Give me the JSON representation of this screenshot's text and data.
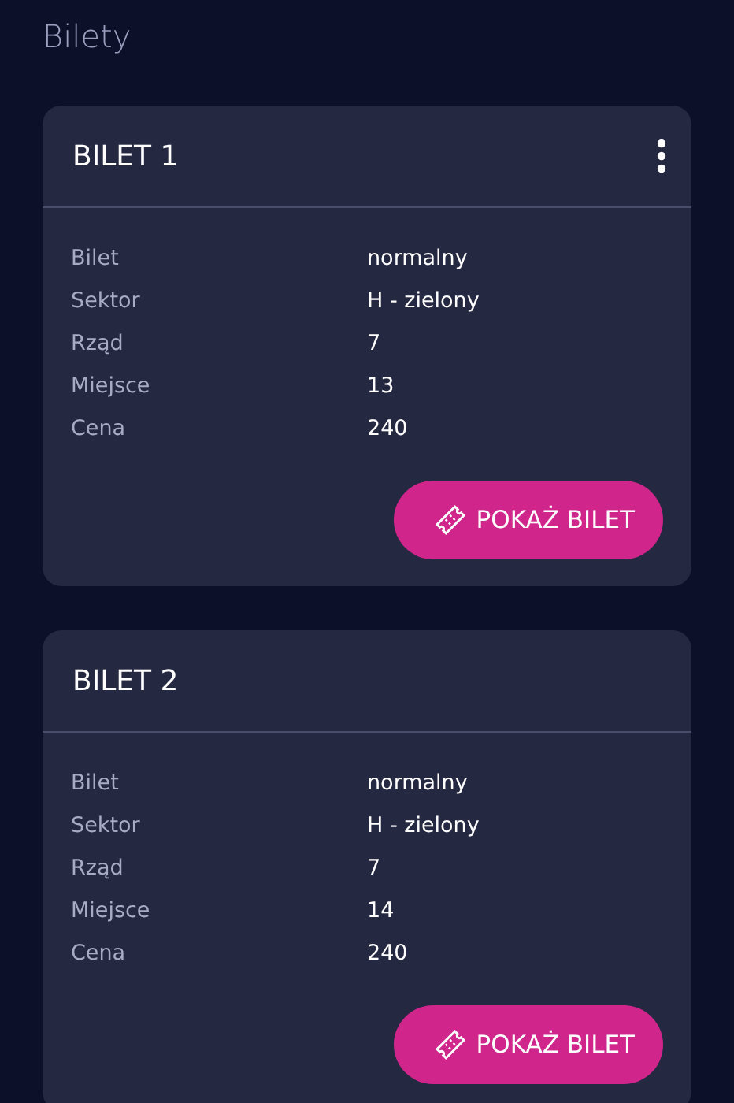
{
  "title": "Bilety",
  "tickets": [
    {
      "name": "BILET 1",
      "menu": true,
      "rows": [
        {
          "label": "Bilet",
          "value": "normalny"
        },
        {
          "label": "Sektor",
          "value": "H - zielony"
        },
        {
          "label": "Rząd",
          "value": "7"
        },
        {
          "label": "Miejsce",
          "value": "13"
        },
        {
          "label": "Cena",
          "value": "240"
        }
      ],
      "button": "POKAŻ BILET"
    },
    {
      "name": "BILET 2",
      "menu": false,
      "rows": [
        {
          "label": "Bilet",
          "value": "normalny"
        },
        {
          "label": "Sektor",
          "value": "H - zielony"
        },
        {
          "label": "Rząd",
          "value": "7"
        },
        {
          "label": "Miejsce",
          "value": "14"
        },
        {
          "label": "Cena",
          "value": "240"
        }
      ],
      "button": "POKAŻ BILET"
    }
  ]
}
